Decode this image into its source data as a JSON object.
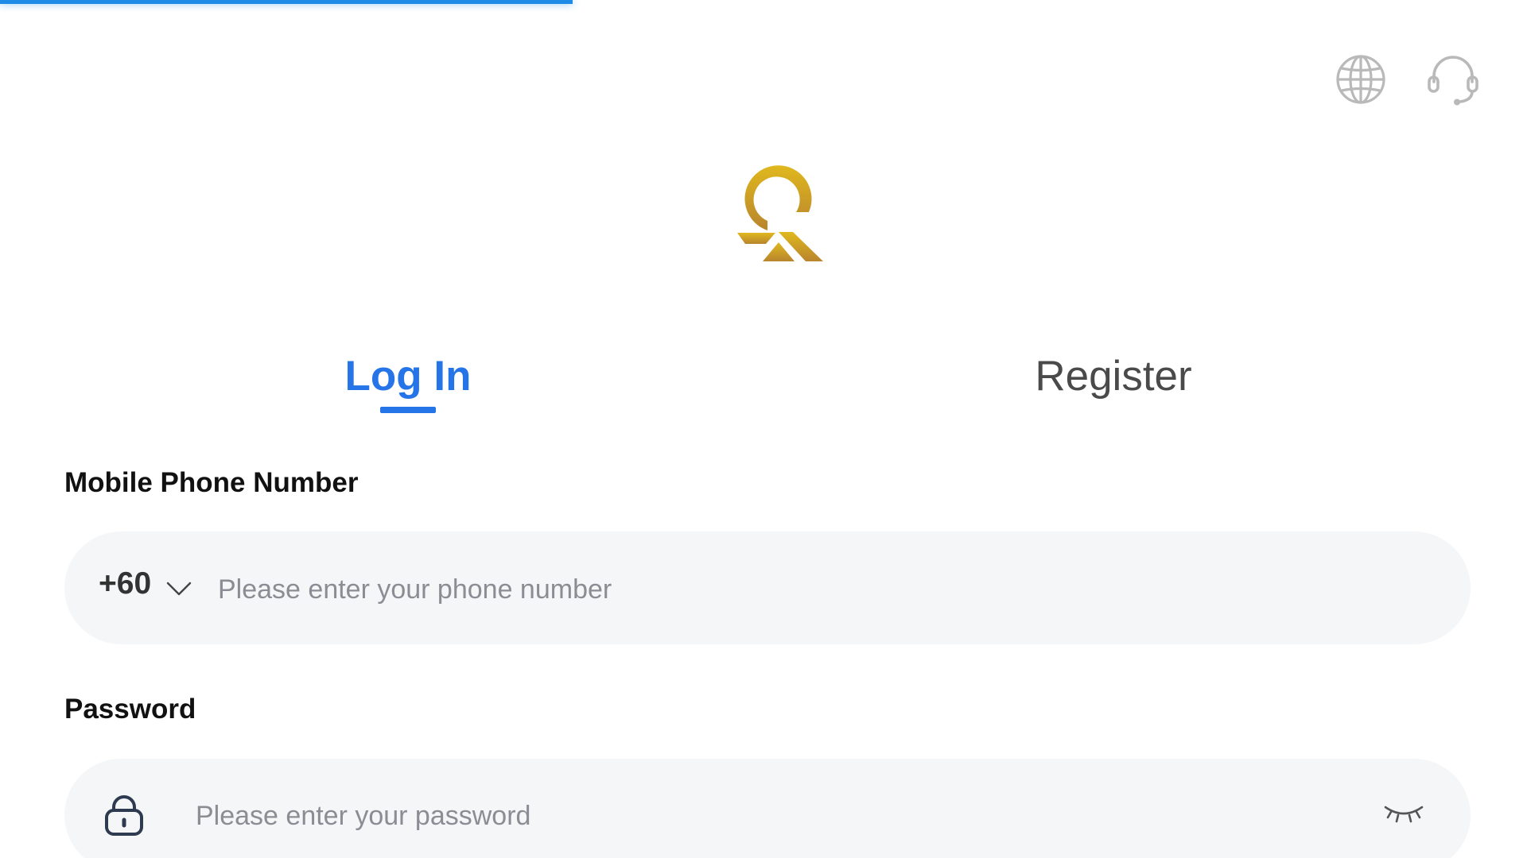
{
  "header": {
    "language_icon": "globe-icon",
    "support_icon": "headset-icon",
    "icon_color": "#b9b9b9"
  },
  "brand": {
    "logo_icon": "q-logo-icon",
    "gold_light": "#e0b81e",
    "gold_dark": "#b8852d"
  },
  "tabs": {
    "login_label": "Log In",
    "register_label": "Register",
    "active": "login",
    "active_color": "#2575e8"
  },
  "form": {
    "phone": {
      "label": "Mobile Phone Number",
      "country_code": "+60",
      "placeholder": "Please enter your phone number",
      "value": ""
    },
    "password": {
      "label": "Password",
      "placeholder": "Please enter your password",
      "value": "",
      "visibility_icon": "eye-closed-icon"
    }
  },
  "accent": "#1e8be6"
}
